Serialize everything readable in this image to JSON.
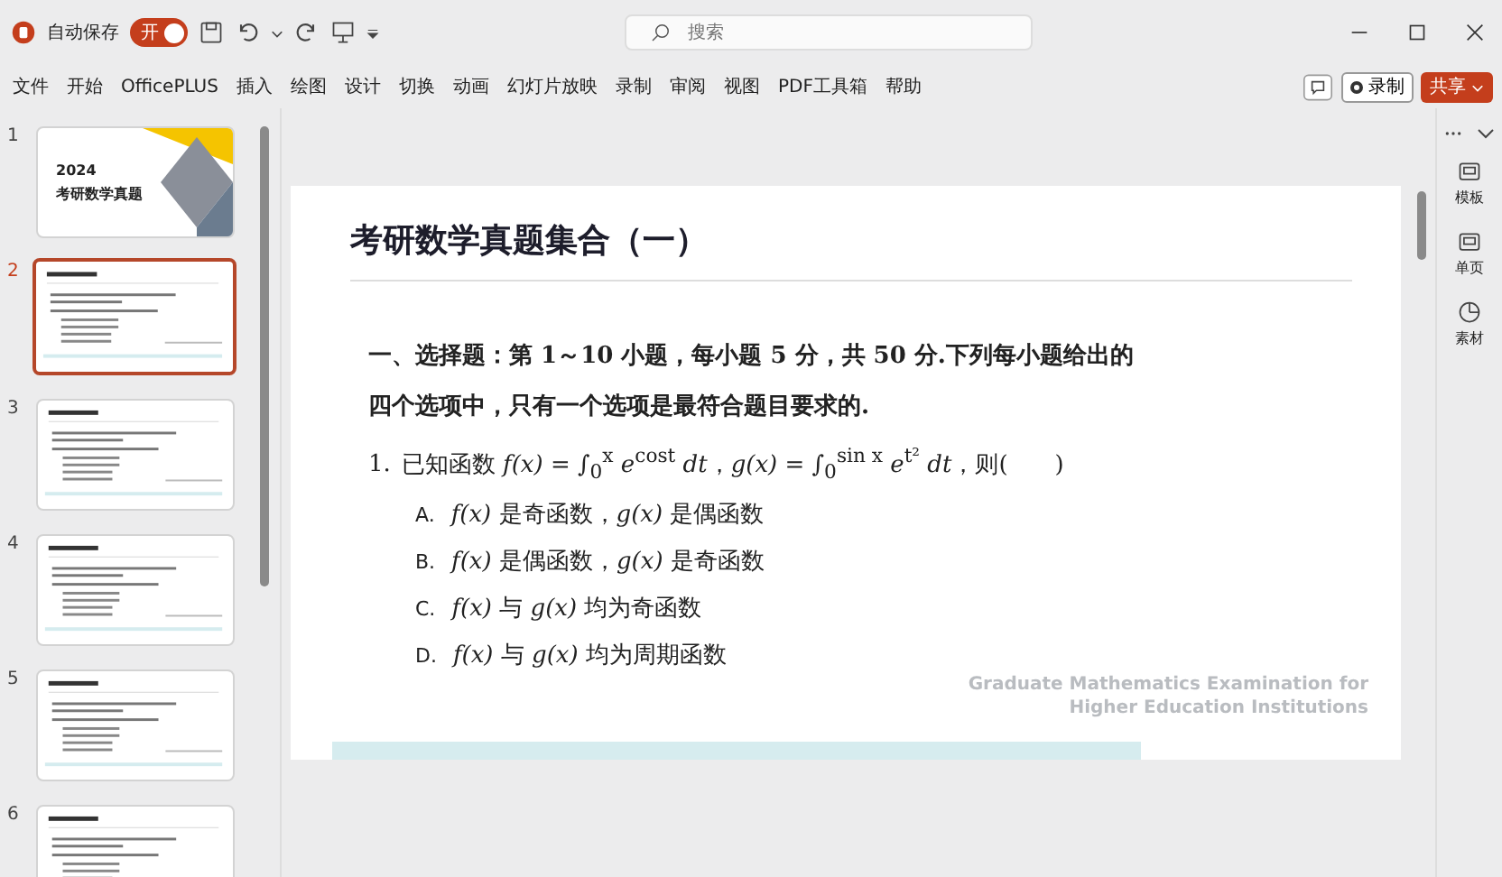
{
  "titlebar": {
    "autosave_label": "自动保存",
    "autosave_toggle": {
      "label": "开",
      "on": true
    },
    "search": {
      "placeholder": "搜索"
    }
  },
  "menu": [
    "文件",
    "开始",
    "OfficePLUS",
    "插入",
    "绘图",
    "设计",
    "切换",
    "动画",
    "幻灯片放映",
    "录制",
    "审阅",
    "视图",
    "PDF工具箱",
    "帮助"
  ],
  "menu_right": {
    "record": "录制",
    "share": "共享"
  },
  "thumbnails": [
    {
      "number": "1",
      "selected": false,
      "kind": "cover",
      "title_lines": [
        "2024",
        "考研数学真题"
      ]
    },
    {
      "number": "2",
      "selected": true,
      "kind": "content"
    },
    {
      "number": "3",
      "selected": false,
      "kind": "content"
    },
    {
      "number": "4",
      "selected": false,
      "kind": "content"
    },
    {
      "number": "5",
      "selected": false,
      "kind": "content"
    },
    {
      "number": "6",
      "selected": false,
      "kind": "content"
    }
  ],
  "slide": {
    "title": "考研数学真题集合（一）",
    "intro": "一、选择题：第 1～10 小题，每小题 5 分，共 50 分.下列每小题给出的四个选项中，只有一个选项是最符合题目要求的.",
    "question": {
      "number": "1.",
      "text": "已知函数 *f(x)* = ∫$_{0}$$^{x}$ *e*$^{cost}$ *dt*，*g(x)* = ∫$_{0}$$^{sin x}$ *e*$^{t²}$ *dt*，则(　　)"
    },
    "options": [
      {
        "letter": "A.",
        "text": "*f(x)* 是奇函数，*g(x)* 是偶函数"
      },
      {
        "letter": "B.",
        "text": "*f(x)* 是偶函数，*g(x)* 是奇函数"
      },
      {
        "letter": "C.",
        "text": "*f(x)* 与 *g(x)* 均为奇函数"
      },
      {
        "letter": "D.",
        "text": "*f(x)* 与 *g(x)* 均为周期函数"
      }
    ],
    "footer_lines": [
      "Graduate Mathematics Examination for",
      "Higher Education Institutions"
    ]
  },
  "side_pane": [
    "模板",
    "单页",
    "素材"
  ]
}
